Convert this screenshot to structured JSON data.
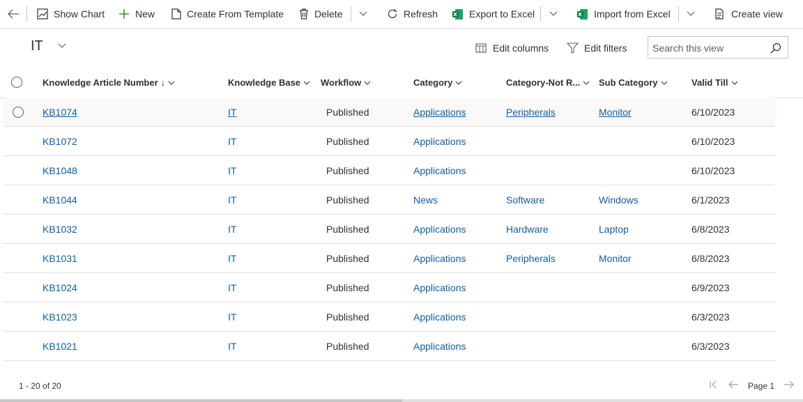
{
  "toolbar": {
    "show_chart": "Show Chart",
    "new": "New",
    "create_from_template": "Create From Template",
    "delete": "Delete",
    "refresh": "Refresh",
    "export_to_excel": "Export to Excel",
    "import_from_excel": "Import from Excel",
    "create_view": "Create view"
  },
  "view": {
    "title": "IT",
    "edit_columns": "Edit columns",
    "edit_filters": "Edit filters",
    "search_placeholder": "Search this view"
  },
  "columns": [
    {
      "label": "Knowledge Article Number",
      "sort": "↓"
    },
    {
      "label": "Knowledge Base"
    },
    {
      "label": "Workflow"
    },
    {
      "label": "Category"
    },
    {
      "label": "Category-Not R..."
    },
    {
      "label": "Sub Category"
    },
    {
      "label": "Valid Till"
    }
  ],
  "rows": [
    {
      "number": "KB1074",
      "kb": "IT",
      "workflow": "Published",
      "category": "Applications",
      "category_not": "Peripherals",
      "sub": "Monitor",
      "valid": "6/10/2023"
    },
    {
      "number": "KB1072",
      "kb": "IT",
      "workflow": "Published",
      "category": "Applications",
      "category_not": "",
      "sub": "",
      "valid": "6/10/2023"
    },
    {
      "number": "KB1048",
      "kb": "IT",
      "workflow": "Published",
      "category": "Applications",
      "category_not": "",
      "sub": "",
      "valid": "6/10/2023"
    },
    {
      "number": "KB1044",
      "kb": "IT",
      "workflow": "Published",
      "category": "News",
      "category_not": "Software",
      "sub": "Windows",
      "valid": "6/1/2023"
    },
    {
      "number": "KB1032",
      "kb": "IT",
      "workflow": "Published",
      "category": "Applications",
      "category_not": "Hardware",
      "sub": "Laptop",
      "valid": "6/8/2023"
    },
    {
      "number": "KB1031",
      "kb": "IT",
      "workflow": "Published",
      "category": "Applications",
      "category_not": "Peripherals",
      "sub": "Monitor",
      "valid": "6/8/2023"
    },
    {
      "number": "KB1024",
      "kb": "IT",
      "workflow": "Published",
      "category": "Applications",
      "category_not": "",
      "sub": "",
      "valid": "6/9/2023"
    },
    {
      "number": "KB1023",
      "kb": "IT",
      "workflow": "Published",
      "category": "Applications",
      "category_not": "",
      "sub": "",
      "valid": "6/3/2023"
    },
    {
      "number": "KB1021",
      "kb": "IT",
      "workflow": "Published",
      "category": "Applications",
      "category_not": "",
      "sub": "",
      "valid": "6/3/2023"
    }
  ],
  "footer": {
    "count": "1 - 20 of 20",
    "page": "Page 1"
  },
  "colors": {
    "link": "#115ea3",
    "excel_green": "#107c41",
    "new_green": "#107c10"
  },
  "icons": [
    "back-arrow-icon",
    "chart-icon",
    "plus-icon",
    "document-icon",
    "trash-icon",
    "refresh-icon",
    "excel-icon",
    "chevron-down-icon",
    "create-view-icon",
    "edit-columns-icon",
    "filter-icon",
    "search-icon",
    "first-page-icon",
    "prev-page-icon",
    "next-page-icon"
  ]
}
